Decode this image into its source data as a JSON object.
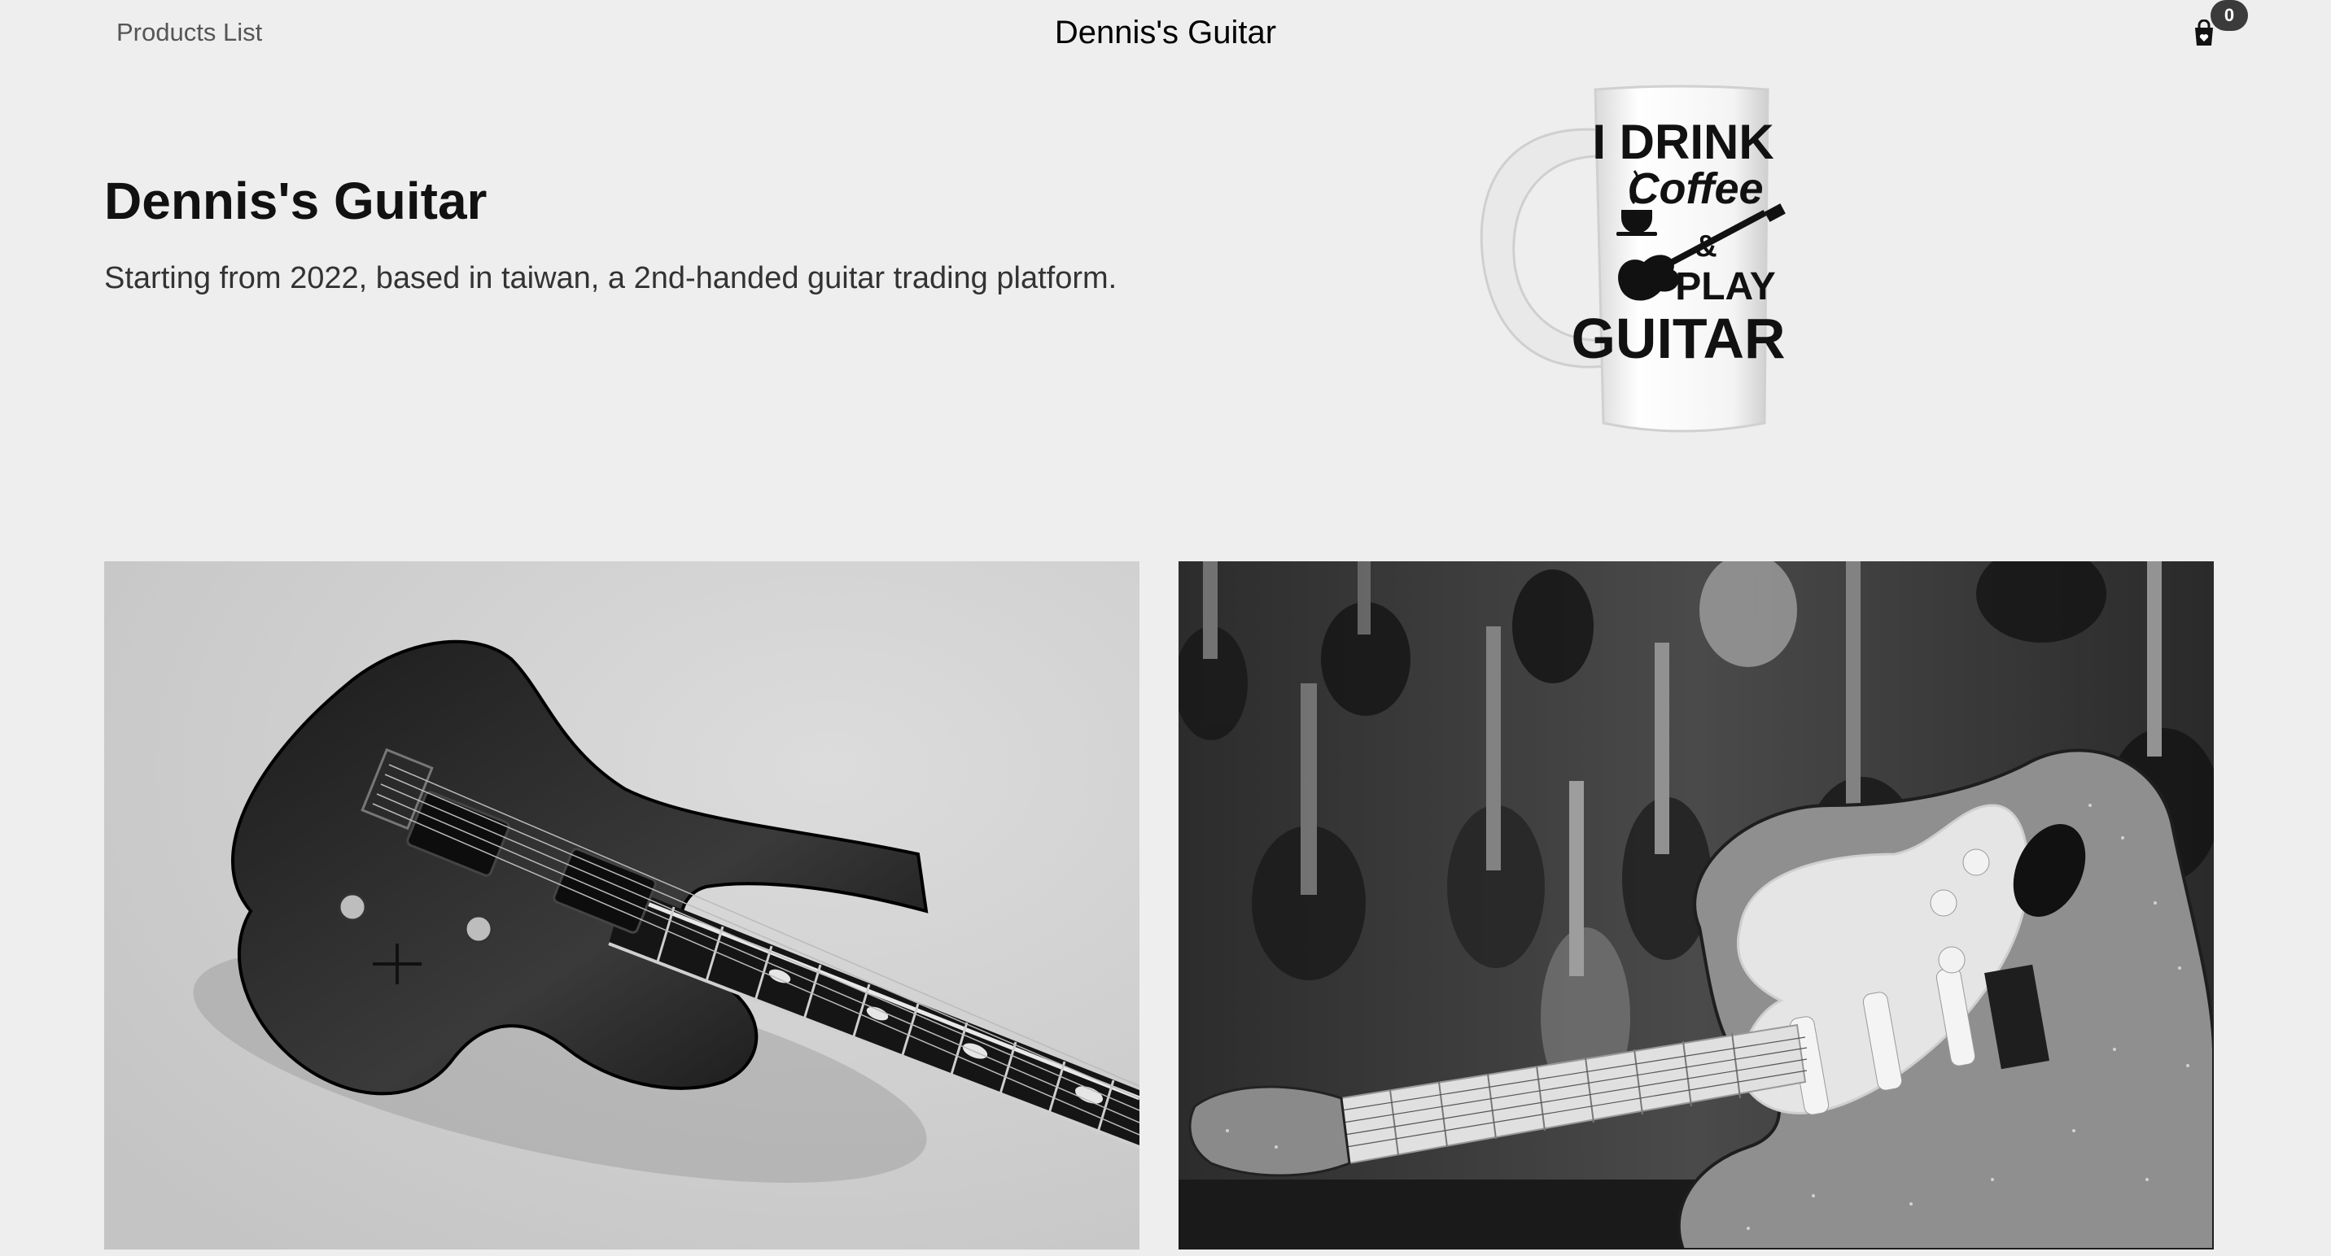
{
  "header": {
    "nav_link": "Products List",
    "brand": "Dennis's Guitar",
    "cart_count": "0",
    "cart_icon": "shopping-bag-icon"
  },
  "hero": {
    "title": "Dennis's Guitar",
    "subtitle": "Starting from 2022, based in taiwan, a 2nd-handed guitar trading platform.",
    "mug_lines": [
      "I DRINK",
      "Coffee",
      "&",
      "PLAY",
      "GUITAR"
    ]
  },
  "products": [
    {
      "image": "black electric guitar"
    },
    {
      "image": "sparkle stratocaster in guitar shop"
    }
  ],
  "colors": {
    "background": "#eeeeee",
    "text": "#111111",
    "subtext": "#333333",
    "badge": "#3b3b3b"
  }
}
